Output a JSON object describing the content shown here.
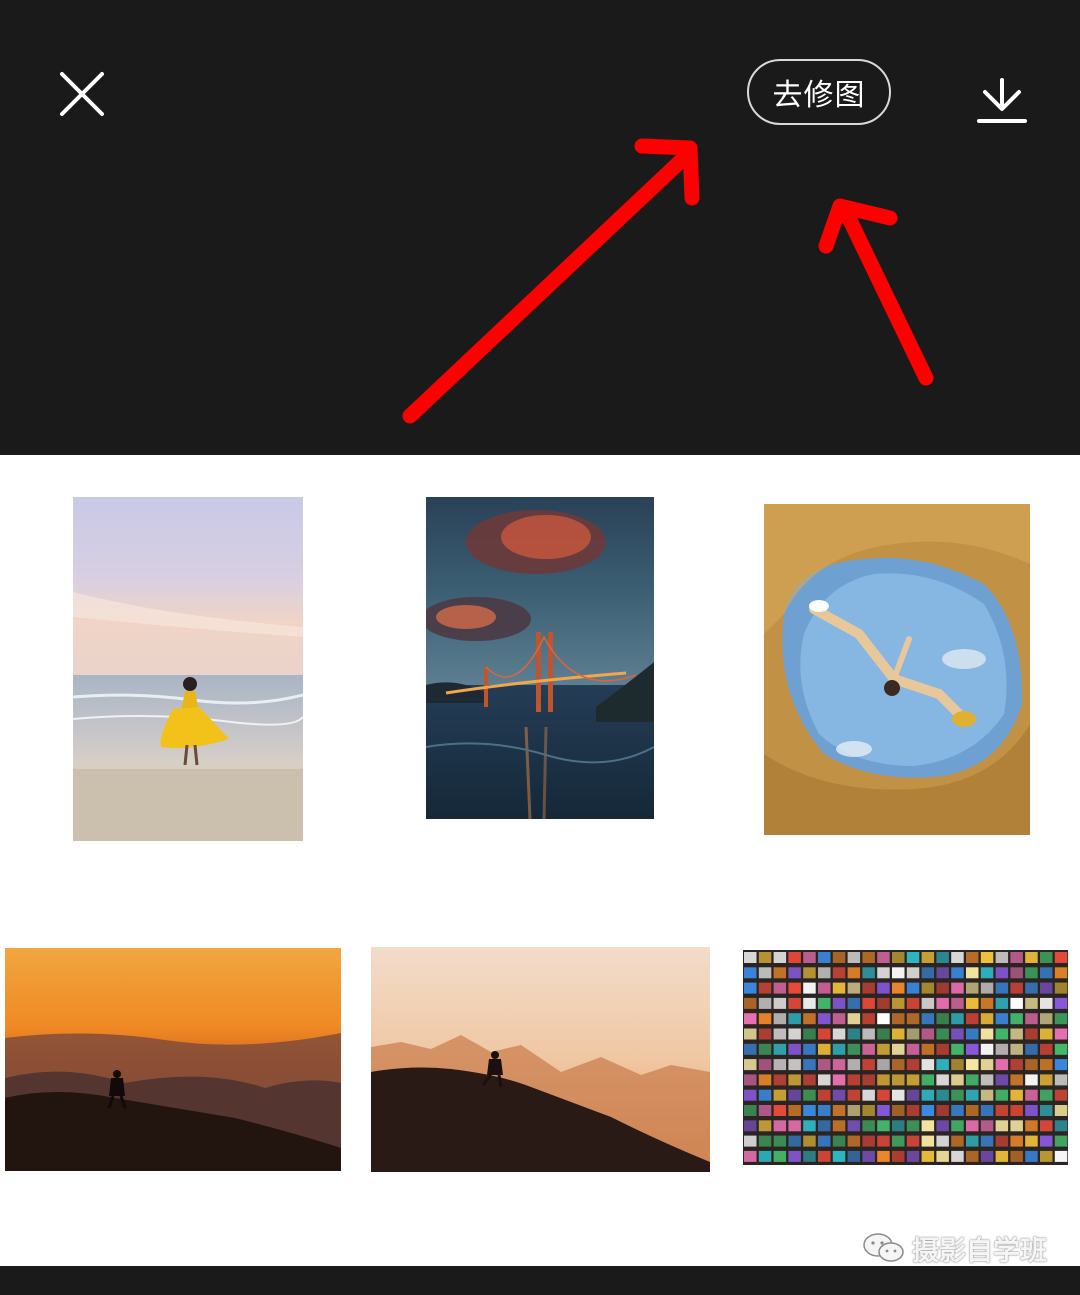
{
  "toolbar": {
    "close_icon": "close-icon",
    "edit_label": "去修图",
    "download_icon": "download-icon"
  },
  "annotations": {
    "arrow_color": "#ff0000",
    "arrows": [
      "arrow-to-edit-button",
      "arrow-to-download-button"
    ]
  },
  "gallery": {
    "photos": [
      "beach-dancer-photo",
      "golden-gate-bridge-photo",
      "cave-jumper-photo",
      "mountain-hiker-sunset-photo",
      "mountain-silhouette-photo",
      "night-market-aerial-photo"
    ]
  },
  "watermark": {
    "text": "摄影自学班",
    "icon": "wechat-icon"
  }
}
